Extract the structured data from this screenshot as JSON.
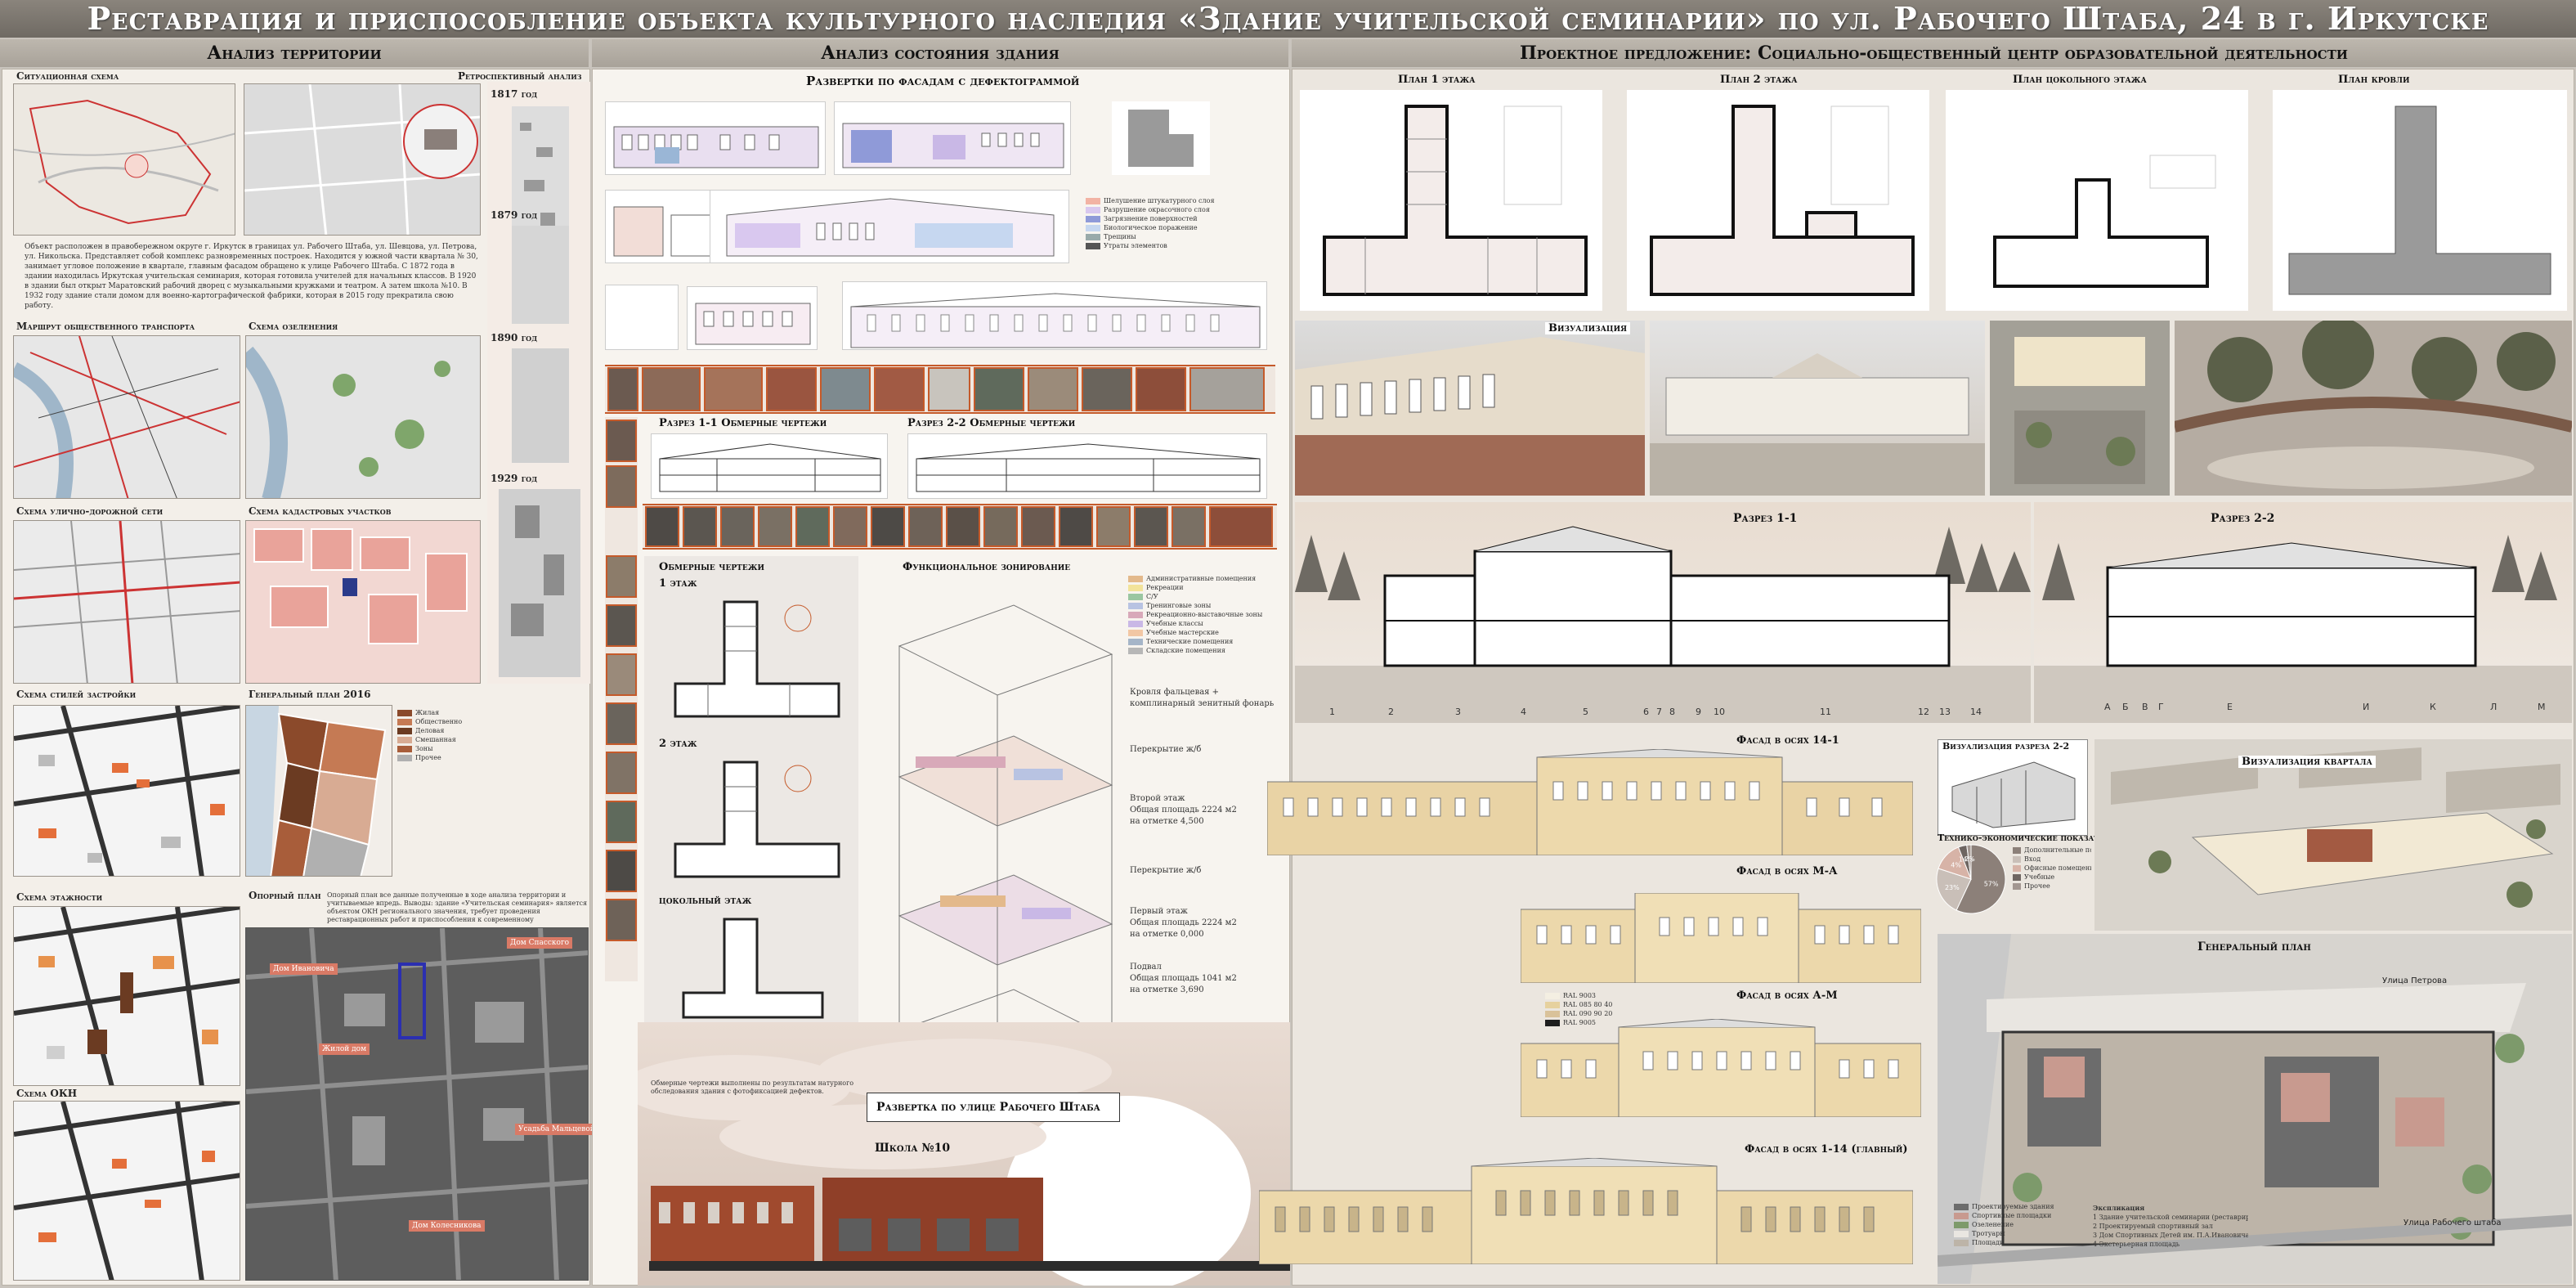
{
  "title": "Реставрация и приспособление объекта культурного наследия «Здание учительской семинарии» по ул. Рабочего Штаба, 24 в г. Иркутске",
  "sections": {
    "left": "Анализ территории",
    "middle": "Анализ состояния здания",
    "right": "Проектное предложение: Социально-общественный центр образовательной деятельности"
  },
  "left": {
    "situational": "Ситуационная схема",
    "retro": "Ретроспективный анализ",
    "years": [
      "1817 год",
      "1879 год",
      "1890 год",
      "1929 год"
    ],
    "desc": "Объект расположен в правобережном округе г. Иркутск в границах ул. Рабочего Штаба, ул. Шевцова, ул. Петрова, ул. Никольска. Представляет собой комплекс разновременных построек. Находится у южной части квартала № 30, занимает угловое положение в квартале, главным фасадом обращено к улице Рабочего Штаба. С 1872 года в здании находилась Иркутская учительская семинария, которая готовила учителей для начальных классов. В 1920 в здании был открыт Маратовский рабочий дворец с музыкальными кружками и театром. А затем школа №10. В 1932 году здание стали домом для военно-картографической фабрики, которая в 2015 году прекратила свою работу.",
    "transport": "Маршрут общественного транспорта",
    "greenery": "Схема озеленения",
    "roads": "Схема улично-дорожной сети",
    "cadastre": "Схема кадастровых участков",
    "styles": "Схема стилей застройки",
    "genplan": "Генеральный план 2016",
    "floors": "Схема этажности",
    "okn": "Схема ОКН",
    "support": "Опорный план",
    "support_text": "Опорный план все данные полученные в ходе анализа территории и учитываемые впредь. Выводы: здание «Учительская семинария» является объектом ОКН регионального значения, требует проведения реставрационных работ и приспособления к современному использованию."
  },
  "middle": {
    "facades": "Развертки по фасадам с дефектограммой",
    "sec11": "Разрез 1-1   Обмерные чертежи",
    "sec22": "Разрез 2-2   Обмерные чертежи",
    "measured": "Обмерные чертежи",
    "floor1": "1 этаж",
    "floor2": "2 этаж",
    "basement": "цокольный этаж",
    "zoning": "Функциональное зонирование",
    "zoning_legend": [
      "Административные помещения",
      "Рекреации",
      "С/У",
      "Тренинговые зоны",
      "Рекреационно-выставочные зоны",
      "Учебные классы",
      "Учебные мастерские",
      "Технические помещения",
      "Складские помещения"
    ],
    "annot": [
      "Кровля фальцевая + комплинарный зенитный фонарь",
      "Перекрытие ж/б",
      "Второй этаж",
      "Общая площадь 2224 м2",
      "на отметке 4,500",
      "Перекрытие ж/б",
      "Первый этаж",
      "Общая площадь 2224 м2",
      "на отметке 0,000",
      "Подвал",
      "Общая площадь 1041 м2",
      "на отметке 3,690"
    ],
    "street_unfold": "Развертка по улице Рабочего Штаба",
    "school": "Школа №10"
  },
  "right": {
    "plans": [
      "План 1 этажа",
      "План 2 этажа",
      "План цокольного этажа",
      "План кровли"
    ],
    "viz": "Визуализация",
    "cut11": "Разрез 1-1",
    "cut22": "Разрез 2-2",
    "axes11": [
      "1",
      "2",
      "3",
      "4",
      "5",
      "6",
      "7",
      "8",
      "9",
      "10",
      "11",
      "12",
      "13",
      "14"
    ],
    "axes22": [
      "А",
      "Б",
      "В",
      "Г",
      "Е",
      "И",
      "К",
      "Л",
      "М"
    ],
    "fac1": "Фасад в осях 14-1",
    "fac2": "Фасад в осях М-А",
    "fac3": "Фасад в осях А-М",
    "fac4": "Фасад в осях 1-14 (главный)",
    "viz_cut": "Визуализация разреза 2-2",
    "tep": "Технико-экономические показатели",
    "viz_block": "Визуализация квартала",
    "gen": "Генеральный план",
    "street_petrova": "Улица Петрова",
    "street_rsh": "Улица Рабочего штаба",
    "ral": [
      "RAL 9003",
      "RAL 085 80 40",
      "RAL 090 90 20",
      "RAL 9005"
    ],
    "pie": {
      "slices": [
        {
          "label": "Дополнительные помещения",
          "value": 57,
          "color": "#8c8079"
        },
        {
          "label": "Вход",
          "value": 23,
          "color": "#c9bfb8"
        },
        {
          "label": "Офисные помещения",
          "value": 14,
          "color": "#d7b3a7"
        },
        {
          "label": "Учебные",
          "value": 4,
          "color": "#6e6561"
        },
        {
          "label": "Прочее",
          "value": 2,
          "color": "#a39791"
        }
      ],
      "labels": [
        "57%",
        "23%",
        "4%",
        "14%",
        "2%"
      ]
    },
    "exp_title": "Экспликация",
    "exp": [
      "1  Здание учительской семинарии (реставрируемое здание)",
      "2  Проектируемый спортивный зал",
      "3  Дом Спортивных Детей им. П.А.Ивановича",
      "4  Экстерьерная площадь"
    ]
  },
  "colors": {
    "accent": "#c55a2a",
    "panel": "#f3efe9",
    "bar": "#7a746c"
  }
}
